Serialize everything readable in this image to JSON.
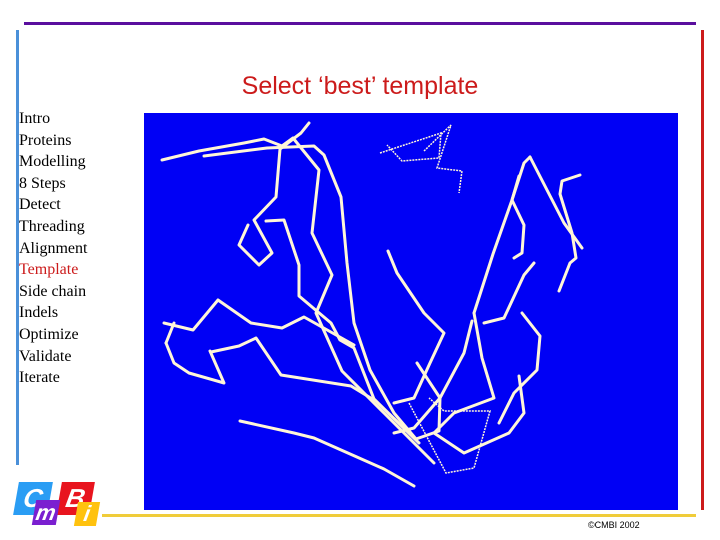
{
  "slide": {
    "title": "Select ‘best’ template",
    "footer": "©CMBI 2002"
  },
  "nav": {
    "items": [
      {
        "label": "Intro",
        "active": false
      },
      {
        "label": "Proteins",
        "active": false
      },
      {
        "label": "Modelling",
        "active": false
      },
      {
        "label": "8 Steps",
        "active": false
      },
      {
        "label": "Detect",
        "active": false
      },
      {
        "label": "Threading",
        "active": false
      },
      {
        "label": "Alignment",
        "active": false
      },
      {
        "label": "Template",
        "active": true
      },
      {
        "label": "Side chain",
        "active": false
      },
      {
        "label": "Indels",
        "active": false
      },
      {
        "label": "Optimize",
        "active": false
      },
      {
        "label": "Validate",
        "active": false
      },
      {
        "label": "Iterate",
        "active": false
      }
    ]
  },
  "logo": {
    "letters": {
      "c": "C",
      "m": "m",
      "b": "B",
      "i": "i"
    }
  },
  "figure": {
    "description": "Superimposed protein C-alpha backbone traces",
    "background_color": "#0000f5",
    "trace_color": "#fff6d8"
  },
  "colors": {
    "title": "#cc1b1b",
    "active_nav": "#cc1b1b",
    "top_rule": "#5a0f9e",
    "left_rule": "#4a90d9",
    "right_rule": "#cc1b1b",
    "bottom_rule": "#f0cc3a"
  }
}
